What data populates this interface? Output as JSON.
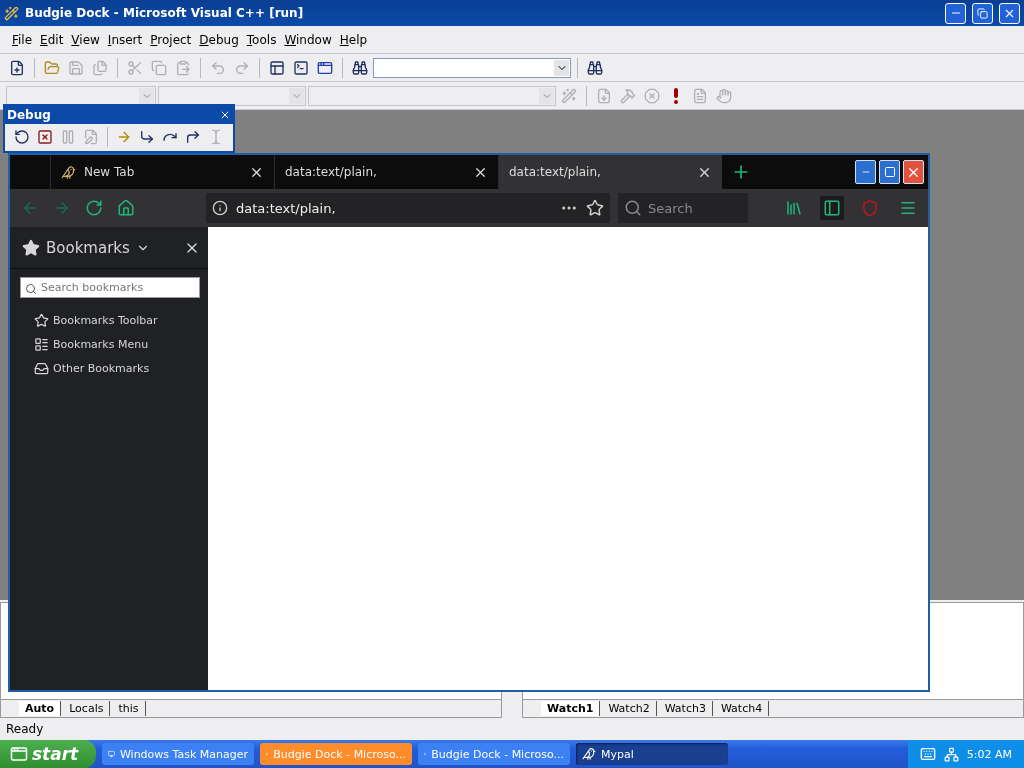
{
  "window": {
    "title": "Budgie Dock - Microsoft Visual C++ [run]"
  },
  "menu": [
    "File",
    "Edit",
    "View",
    "Insert",
    "Project",
    "Debug",
    "Tools",
    "Window",
    "Help"
  ],
  "toolbar": [
    {
      "kind": "new",
      "disabled": false
    },
    {
      "kind": "sep"
    },
    {
      "kind": "open",
      "disabled": false
    },
    {
      "kind": "save",
      "disabled": true
    },
    {
      "kind": "saveall",
      "disabled": true
    },
    {
      "kind": "sep"
    },
    {
      "kind": "cut",
      "disabled": true
    },
    {
      "kind": "copy",
      "disabled": true
    },
    {
      "kind": "paste",
      "disabled": true
    },
    {
      "kind": "sep"
    },
    {
      "kind": "undo",
      "disabled": true
    },
    {
      "kind": "redo",
      "disabled": true
    },
    {
      "kind": "sep"
    },
    {
      "kind": "workspace",
      "disabled": false
    },
    {
      "kind": "output",
      "disabled": false
    },
    {
      "kind": "windows",
      "disabled": false
    },
    {
      "kind": "sep"
    },
    {
      "kind": "findfiles",
      "disabled": false
    },
    {
      "kind": "combo"
    },
    {
      "kind": "sep"
    },
    {
      "kind": "find",
      "disabled": false
    }
  ],
  "build_toolbar": [
    {
      "kind": "compile",
      "disabled": true
    },
    {
      "kind": "build",
      "disabled": true
    },
    {
      "kind": "stop",
      "disabled": true
    },
    {
      "kind": "execute",
      "disabled": false
    },
    {
      "kind": "go",
      "disabled": true
    },
    {
      "kind": "breakpoint",
      "disabled": true
    }
  ],
  "debug_toolbar": {
    "title": "Debug",
    "items": [
      {
        "kind": "restart",
        "disabled": false
      },
      {
        "kind": "stopdebug",
        "disabled": false
      },
      {
        "kind": "break",
        "disabled": true
      },
      {
        "kind": "apply",
        "disabled": true
      },
      {
        "kind": "sep"
      },
      {
        "kind": "next",
        "disabled": false
      },
      {
        "kind": "stepinto",
        "disabled": false
      },
      {
        "kind": "stepover",
        "disabled": false
      },
      {
        "kind": "stepout",
        "disabled": false
      },
      {
        "kind": "runcursor",
        "disabled": true
      }
    ]
  },
  "browser": {
    "tabs": [
      {
        "label": "New Tab",
        "kind": "favicon",
        "selected": false
      },
      {
        "label": "data:text/plain,",
        "kind": "plain",
        "selected": false
      },
      {
        "label": "data:text/plain,",
        "kind": "plain",
        "selected": true
      }
    ],
    "url": "data:text/plain,",
    "search": {
      "placeholder": "Search"
    },
    "toolbar_buttons": [
      {
        "kind": "library",
        "selected": false
      },
      {
        "kind": "sidebar",
        "selected": true
      },
      {
        "kind": "ublock",
        "selected": false
      },
      {
        "kind": "menu",
        "selected": false
      }
    ],
    "sidebar": {
      "title": "Bookmarks",
      "search": {
        "placeholder": "Search bookmarks"
      },
      "items": [
        {
          "label": "Bookmarks Toolbar",
          "kind": "toolbar"
        },
        {
          "label": "Bookmarks Menu",
          "kind": "menu"
        },
        {
          "label": "Other Bookmarks",
          "kind": "other"
        }
      ]
    }
  },
  "variables_tabs": [
    {
      "label": "Auto",
      "selected": true
    },
    {
      "label": "Locals",
      "selected": false
    },
    {
      "label": "this",
      "selected": false
    }
  ],
  "watch_tabs": [
    {
      "label": "Watch1",
      "selected": true
    },
    {
      "label": "Watch2",
      "selected": false
    },
    {
      "label": "Watch3",
      "selected": false
    },
    {
      "label": "Watch4",
      "selected": false
    }
  ],
  "status_bar": "Ready",
  "taskbar": {
    "start": "start",
    "items": [
      {
        "label": "Windows Task Manager",
        "kind": "taskmgr",
        "selected": false,
        "flashing": false
      },
      {
        "label": "Budgie Dock - Microso...",
        "kind": "vc",
        "selected": false,
        "flashing": true
      },
      {
        "label": "Budgie Dock - Microso...",
        "kind": "vc",
        "selected": false,
        "flashing": false
      },
      {
        "label": "Mypal",
        "kind": "browser",
        "selected": true,
        "flashing": false
      }
    ],
    "clock": "5:02 AM"
  }
}
